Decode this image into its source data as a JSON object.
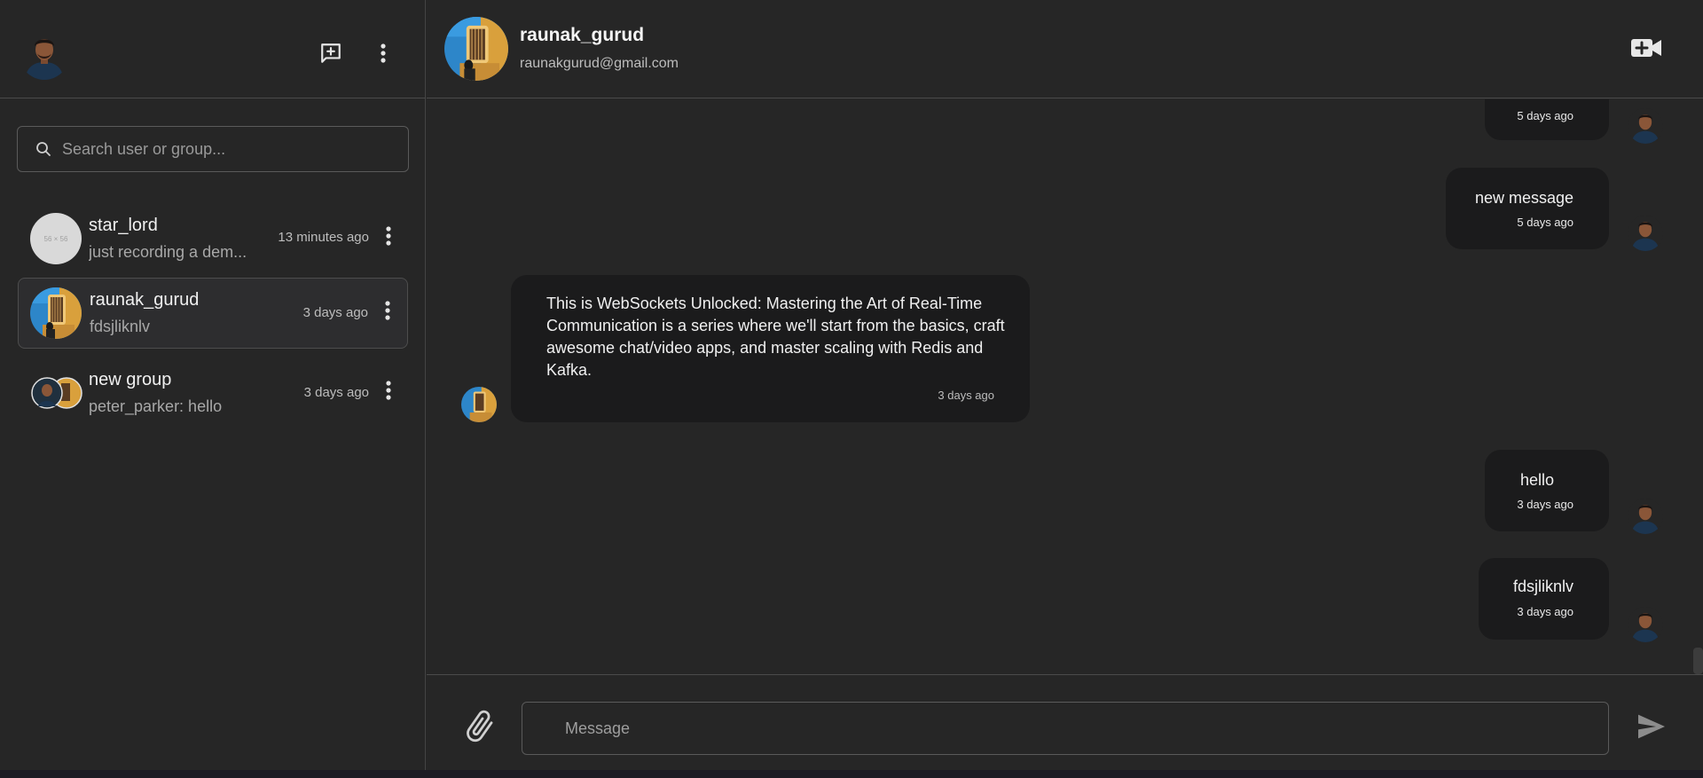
{
  "sidebar": {
    "search": {
      "placeholder": "Search user or group..."
    },
    "chats": [
      {
        "name": "star_lord",
        "preview": "just recording a dem...",
        "time": "13 minutes ago",
        "avatar_text": "56 × 56",
        "active": false
      },
      {
        "name": "raunak_gurud",
        "preview": "fdsjliknlv",
        "time": "3 days ago",
        "active": true
      },
      {
        "name": "new group",
        "preview": "peter_parker: hello",
        "time": "3 days ago",
        "active": false
      }
    ]
  },
  "chat_header": {
    "name": "raunak_gurud",
    "email": "raunakgurud@gmail.com"
  },
  "messages": [
    {
      "from": "me",
      "text": "",
      "time": "5 days ago"
    },
    {
      "from": "me",
      "text": "new message",
      "time": "5 days ago"
    },
    {
      "from": "them",
      "lines": [
        "This is WebSockets Unlocked: Mastering the Art of Real-Time",
        "Communication is a series where we'll start from the basics, craft",
        "awesome chat/video apps, and master scaling with Redis and",
        "Kafka."
      ],
      "time": "3 days ago"
    },
    {
      "from": "me",
      "text": "hello",
      "time": "3 days ago"
    },
    {
      "from": "me",
      "text": "fdsjliknlv",
      "time": "3 days ago"
    }
  ],
  "composer": {
    "placeholder": "Message"
  },
  "colors": {
    "background": "#262626",
    "bubble": "#1b1b1c",
    "divider": "#4a4a4a"
  },
  "icons": [
    "new-chat-icon",
    "more-vert-icon",
    "search-icon",
    "video-call-icon",
    "paperclip-icon",
    "send-icon"
  ]
}
